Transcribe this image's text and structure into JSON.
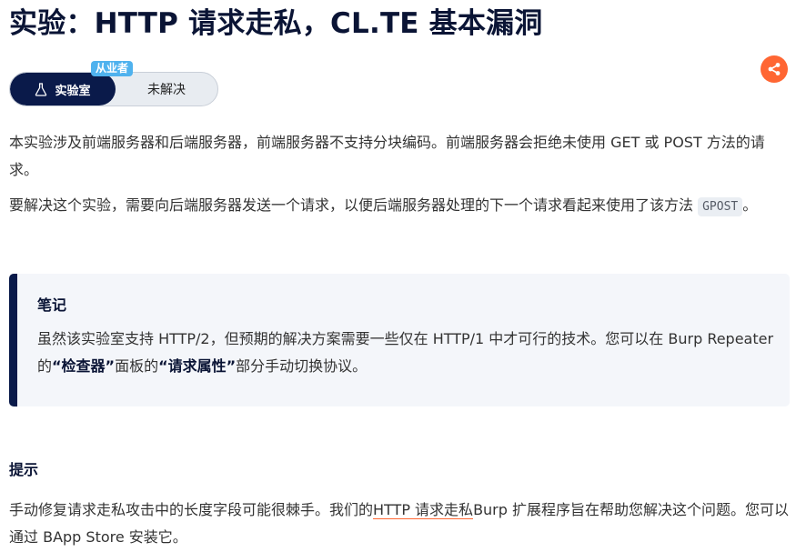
{
  "page": {
    "title": "实验：HTTP 请求走私，CL.TE 基本漏洞"
  },
  "share": {
    "icon": "share-icon",
    "color": "#ff6633"
  },
  "level_badge": "从业者",
  "status_toggle": {
    "lab_label": "实验室",
    "lab_icon": "flask-icon",
    "status_label": "未解决"
  },
  "description": {
    "p1": "本实验涉及前端服务器和后端服务器，前端服务器不支持分块编码。前端服务器会拒绝未使用 GET 或 POST 方法的请求。",
    "p2_before": "要解决这个实验，需要向后端服务器发送一个请求，以便后端服务器处理的下一个请求看起来使用了该方法 ",
    "p2_code": "GPOST",
    "p2_after": "。"
  },
  "note": {
    "title": "笔记",
    "text_1": "虽然该实验室支持 HTTP/2，但预期的解决方案需要一些仅在 HTTP/1 中才可行的技术。您可以在 Burp Repeater 的",
    "inspector": "“检查器”",
    "text_2": "面板的",
    "request_attributes": "“请求属性”",
    "text_3": "部分手动切换协议。"
  },
  "hint": {
    "heading": "提示",
    "text_before": "手动修复请求走私攻击中的长度字段可能很棘手。我们的",
    "link_label": "HTTP 请求走私",
    "text_after": "Burp 扩展程序旨在帮助您解决这个问题。您可以通过 BApp Store 安装它。"
  },
  "colors": {
    "navy": "#0a1a4a",
    "badge_blue": "#4fb2ee",
    "accent_orange": "#ff6633",
    "note_background": "#f4f6fa"
  }
}
